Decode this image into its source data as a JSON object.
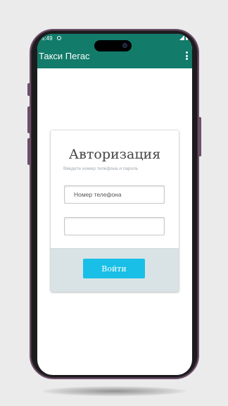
{
  "status_bar": {
    "time": "5:49",
    "left_icon": "circle-notification-icon",
    "right_icons": [
      "signal-icon",
      "battery-icon"
    ]
  },
  "app_bar": {
    "title": "Такси Пегас",
    "menu_icon": "overflow-menu-icon"
  },
  "login_card": {
    "title": "Авторизация",
    "hint": "Введите номер телефона и пароль",
    "phone_placeholder": "Номер телефона",
    "phone_value": "",
    "password_value": "",
    "login_label": "Войти"
  },
  "colors": {
    "app_bar": "#127b6a",
    "button": "#19bfe6",
    "card_footer": "#d9e3e6",
    "phone_frame": "#6b4e67",
    "background": "#ebebeb"
  }
}
